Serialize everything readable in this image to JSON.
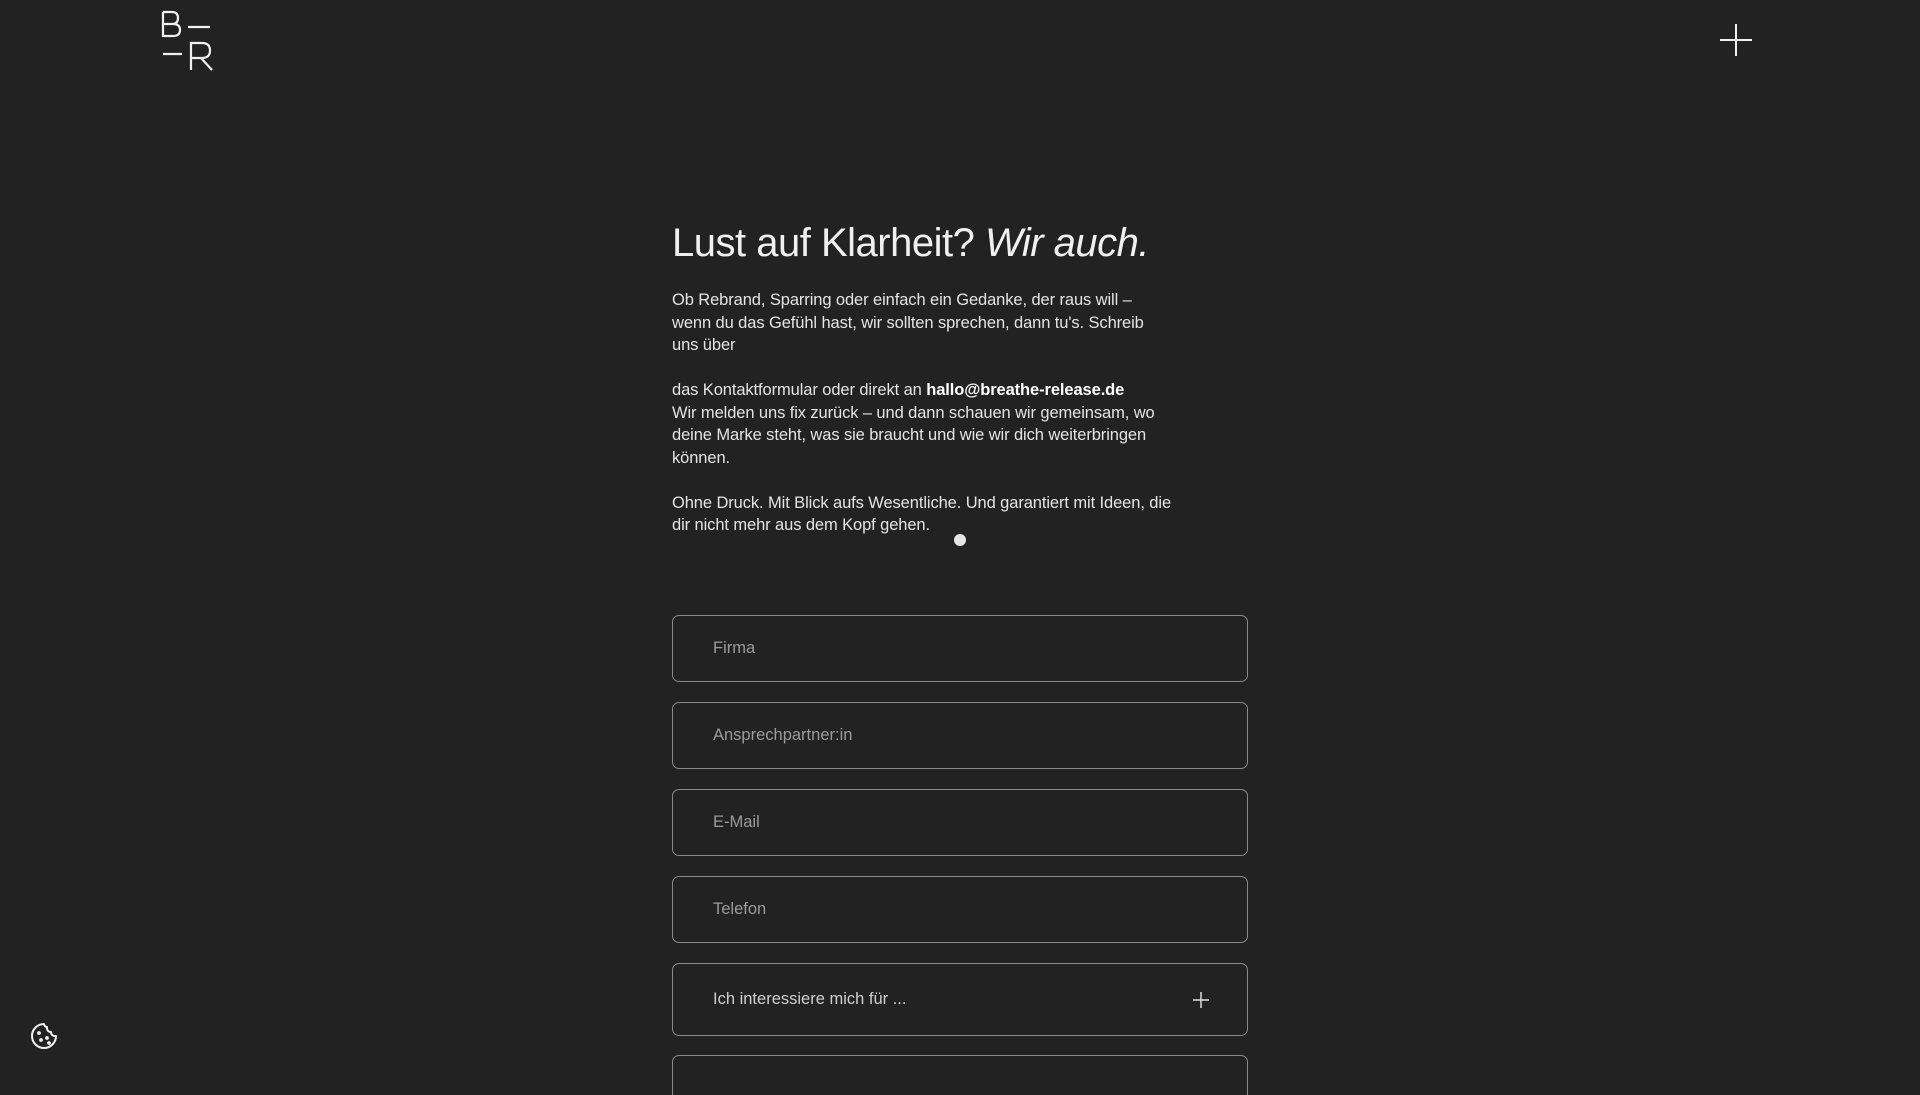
{
  "header": {
    "logo_alt": "B R",
    "logo_icon": "br-logo-icon",
    "menu_icon": "plus-icon"
  },
  "hero": {
    "headline_plain": "Lust auf Klarheit?",
    "headline_italic": "Wir auch.",
    "paragraph1": "Ob Rebrand, Sparring oder einfach ein Gedanke, der raus will – wenn du das Gefühl hast, wir sollten sprechen, dann tu's. Schreib uns über",
    "paragraph2_prefix": "das Kontaktformular oder direkt an",
    "email": "hallo@breathe-release.de",
    "paragraph2_suffix": "Wir melden uns fix zurück – und dann schauen wir gemeinsam, wo deine Marke steht, was sie braucht und wie wir dich weiterbringen können.",
    "paragraph3": "Ohne Druck. Mit Blick aufs Wesentliche. Und garantiert mit Ideen, die dir nicht mehr aus dem Kopf gehen."
  },
  "form": {
    "company_placeholder": "Firma",
    "contact_placeholder": "Ansprechpartner:in",
    "email_placeholder": "E-Mail",
    "phone_placeholder": "Telefon",
    "interest_label": "Ich interessiere mich für ...",
    "interest_icon": "plus-icon"
  },
  "cookie": {
    "icon": "cookie-icon"
  },
  "colors": {
    "background": "#222222",
    "text": "#ededed",
    "border": "#8a8a8a"
  }
}
